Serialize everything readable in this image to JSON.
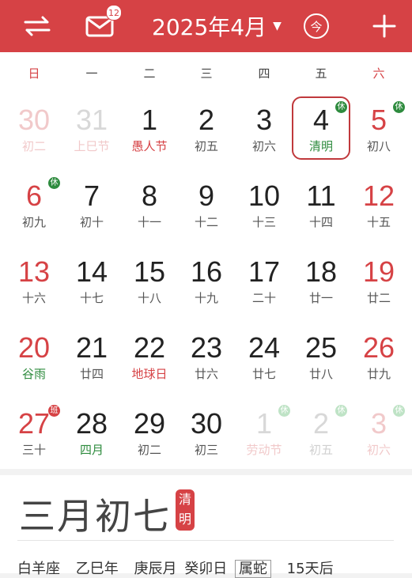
{
  "header": {
    "title": "2025年4月",
    "mail_badge": "12",
    "jump_today_label": "今",
    "accent": "#d64245"
  },
  "weekdays": [
    "日",
    "一",
    "二",
    "三",
    "四",
    "五",
    "六"
  ],
  "days": [
    {
      "n": "30",
      "s": "初二",
      "st": "fadedred"
    },
    {
      "n": "31",
      "s": "上巳节",
      "st": "faded",
      "sub": "fadedfest"
    },
    {
      "n": "1",
      "s": "愚人节",
      "sub": "fest"
    },
    {
      "n": "2",
      "s": "初五"
    },
    {
      "n": "3",
      "s": "初六"
    },
    {
      "n": "4",
      "s": "清明",
      "sub": "term",
      "today": true,
      "tag": "休"
    },
    {
      "n": "5",
      "s": "初八",
      "st": "red",
      "tag": "休"
    },
    {
      "n": "6",
      "s": "初九",
      "st": "red",
      "tag": "休"
    },
    {
      "n": "7",
      "s": "初十"
    },
    {
      "n": "8",
      "s": "十一"
    },
    {
      "n": "9",
      "s": "十二"
    },
    {
      "n": "10",
      "s": "十三"
    },
    {
      "n": "11",
      "s": "十四"
    },
    {
      "n": "12",
      "s": "十五",
      "st": "red"
    },
    {
      "n": "13",
      "s": "十六",
      "st": "red"
    },
    {
      "n": "14",
      "s": "十七"
    },
    {
      "n": "15",
      "s": "十八"
    },
    {
      "n": "16",
      "s": "十九"
    },
    {
      "n": "17",
      "s": "二十"
    },
    {
      "n": "18",
      "s": "廿一"
    },
    {
      "n": "19",
      "s": "廿二",
      "st": "red"
    },
    {
      "n": "20",
      "s": "谷雨",
      "st": "red",
      "sub": "term"
    },
    {
      "n": "21",
      "s": "廿四"
    },
    {
      "n": "22",
      "s": "地球日",
      "sub": "fest"
    },
    {
      "n": "23",
      "s": "廿六"
    },
    {
      "n": "24",
      "s": "廿七"
    },
    {
      "n": "25",
      "s": "廿八"
    },
    {
      "n": "26",
      "s": "廿九",
      "st": "red"
    },
    {
      "n": "27",
      "s": "三十",
      "st": "red",
      "tag": "班",
      "tagtype": "work"
    },
    {
      "n": "28",
      "s": "四月",
      "sub": "term"
    },
    {
      "n": "29",
      "s": "初二"
    },
    {
      "n": "30",
      "s": "初三"
    },
    {
      "n": "1",
      "s": "劳动节",
      "st": "faded",
      "sub": "fadedfest",
      "tag": "休",
      "tagtype": "faint"
    },
    {
      "n": "2",
      "s": "初五",
      "st": "faded",
      "tag": "休",
      "tagtype": "faint"
    },
    {
      "n": "3",
      "s": "初六",
      "st": "fadedred",
      "tag": "休",
      "tagtype": "faint"
    }
  ],
  "detail": {
    "lunar": "三月初七",
    "seal": "清明",
    "zodiac": "白羊座",
    "year_gz": "乙巳年",
    "month_gz": "庚辰月",
    "day_gz": "癸卯日",
    "animal": "属蛇",
    "countdown": "15天后"
  }
}
